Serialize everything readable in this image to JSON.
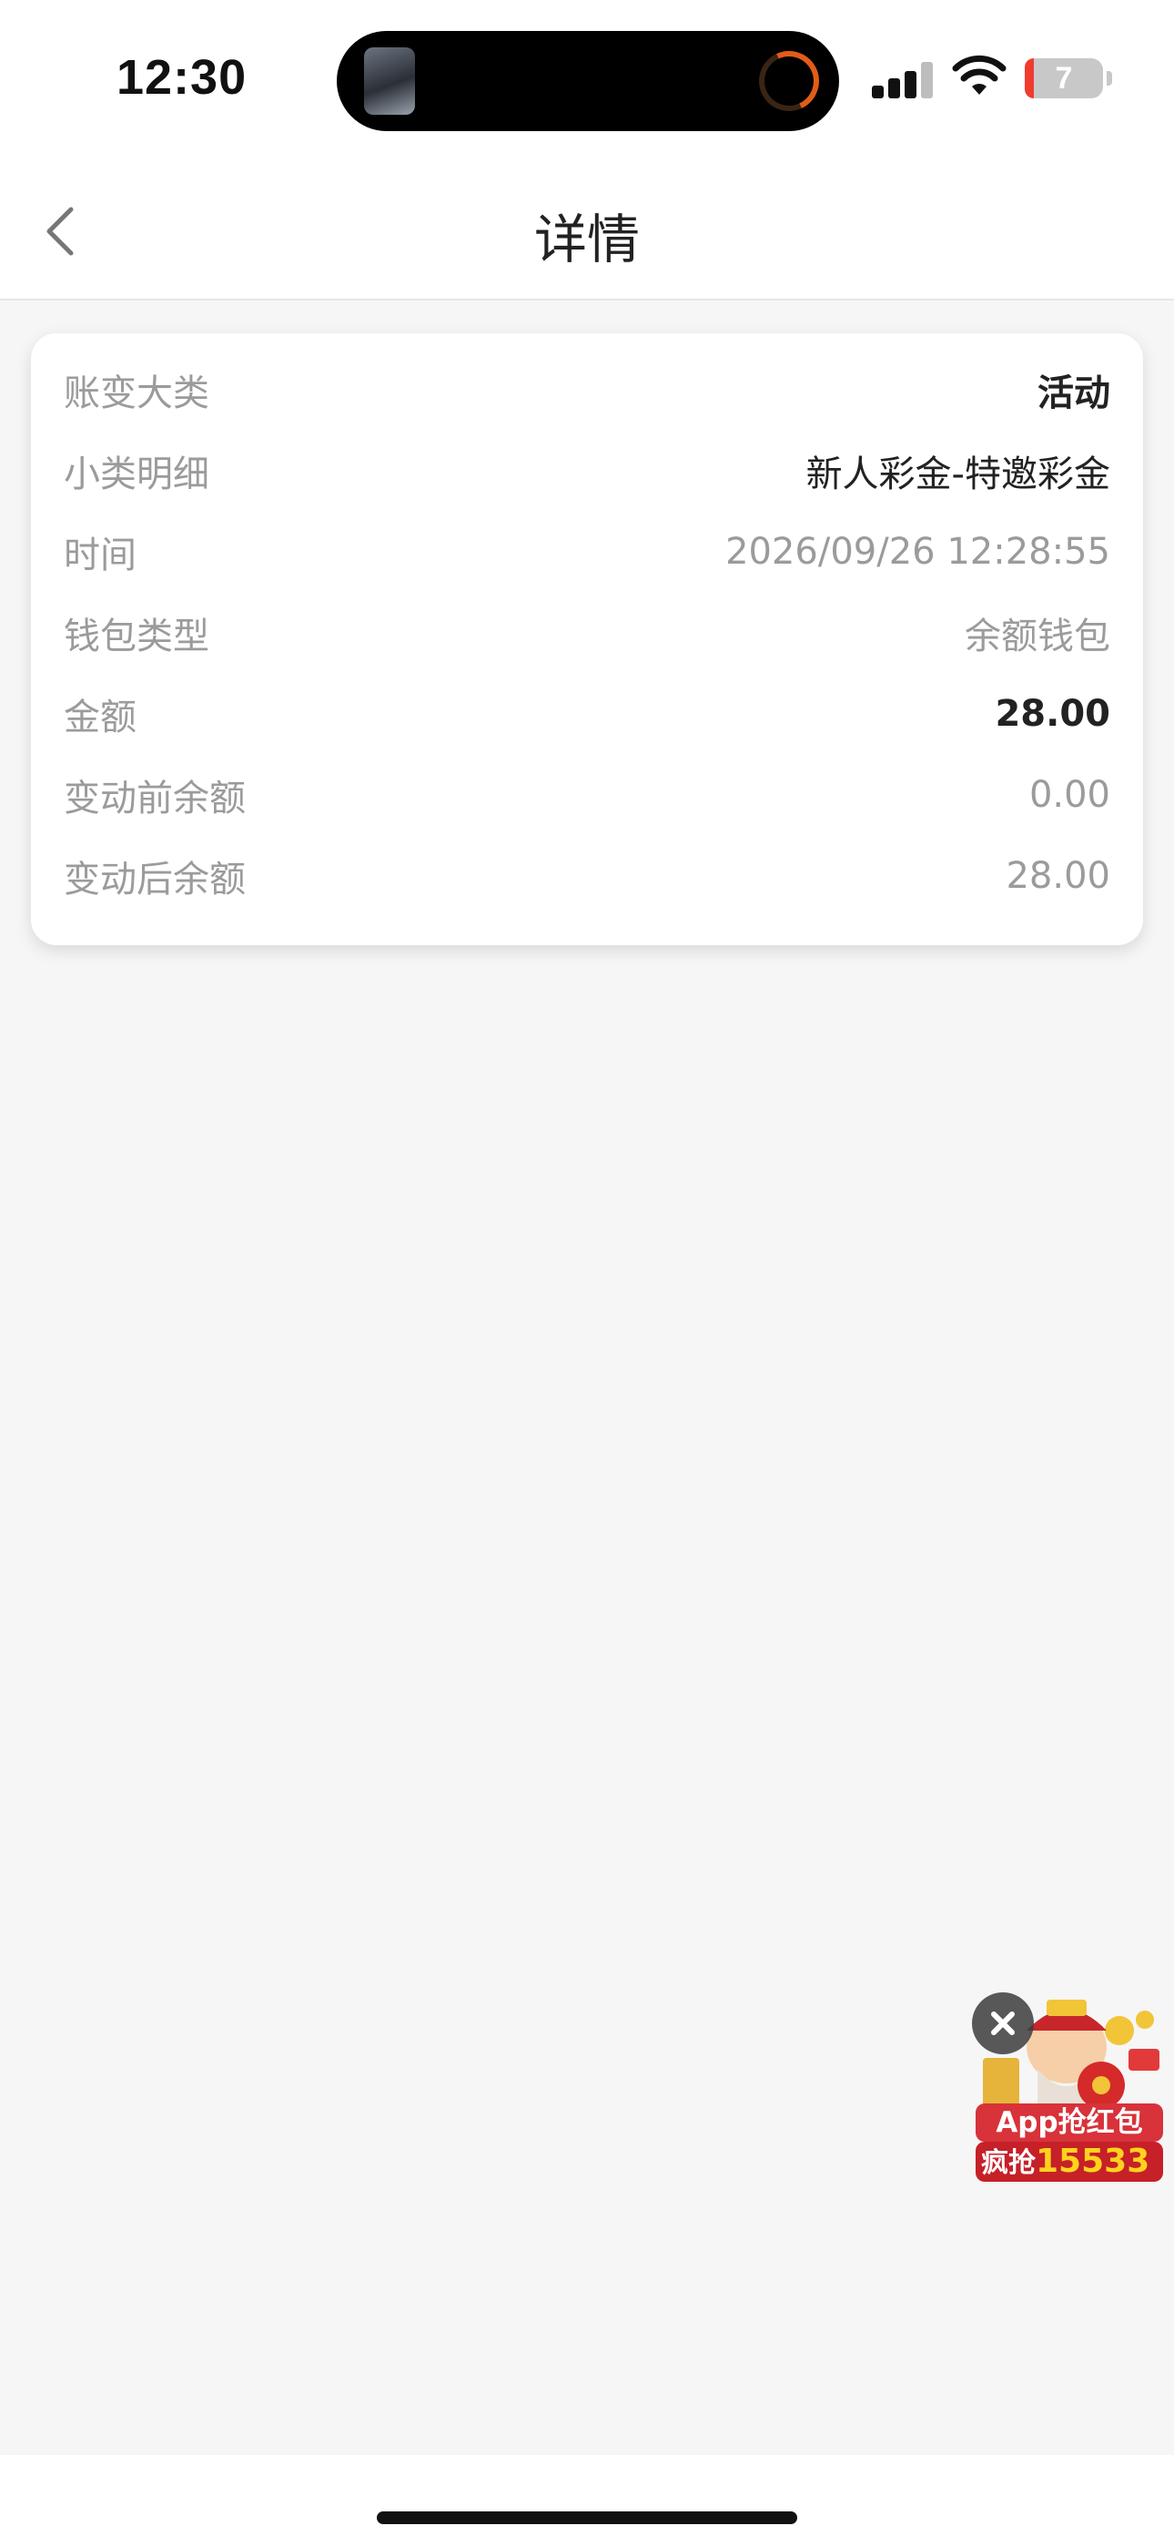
{
  "status_bar": {
    "time": "12:30",
    "battery_level": "7",
    "icons": [
      "signal-icon",
      "wifi-icon",
      "battery-icon"
    ]
  },
  "nav": {
    "title": "详情",
    "back_icon": "chevron-left-icon"
  },
  "detail": {
    "rows": [
      {
        "label": "账变大类",
        "value": "活动"
      },
      {
        "label": "小类明细",
        "value": "新人彩金-特邀彩金"
      },
      {
        "label": "时间",
        "value": "2026/09/26 12:28:55"
      },
      {
        "label": "钱包类型",
        "value": "余额钱包"
      },
      {
        "label": "金额",
        "value": "28.00"
      },
      {
        "label": "变动前余额",
        "value": "0.00"
      },
      {
        "label": "变动后余额",
        "value": "28.00"
      }
    ]
  },
  "promo": {
    "line1": "App抢红包",
    "line2_label": "疯抢",
    "line2_number": "15533"
  },
  "colors": {
    "background": "#f6f6f6",
    "card": "#ffffff",
    "label_gray": "#9b9b9b",
    "text_dark": "#222222",
    "promo_red": "#d8323a",
    "promo_gold": "#ffd21e"
  }
}
